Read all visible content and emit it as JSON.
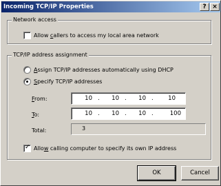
{
  "window": {
    "title": "Incoming TCP/IP Properties",
    "help_button": "?",
    "close_button": "×"
  },
  "network_access": {
    "legend": "Network access",
    "allow_callers": {
      "pre": "Allow ",
      "accel": "c",
      "post": "allers to access my local area network",
      "checked": false
    }
  },
  "tcpip": {
    "legend": "TCP/IP address assignment",
    "dhcp_option": {
      "accel": "A",
      "post": "ssign TCP/IP addresses automatically using DHCP",
      "selected": false
    },
    "specify_option": {
      "accel": "S",
      "post": "pecify TCP/IP addresses",
      "selected": true
    },
    "from": {
      "accel": "F",
      "post": "rom:",
      "octets": [
        "10",
        "10",
        "10",
        "10"
      ]
    },
    "to": {
      "accel": "T",
      "post": "o:",
      "octets": [
        "10",
        "10",
        "10",
        "100"
      ]
    },
    "total": {
      "label": "Total:",
      "value": "3"
    }
  },
  "allow_own_ip": {
    "pre": "Allo",
    "accel": "w",
    "post": " calling computer to specify its own IP address",
    "checked": true
  },
  "buttons": {
    "ok": "OK",
    "cancel": "Cancel"
  }
}
